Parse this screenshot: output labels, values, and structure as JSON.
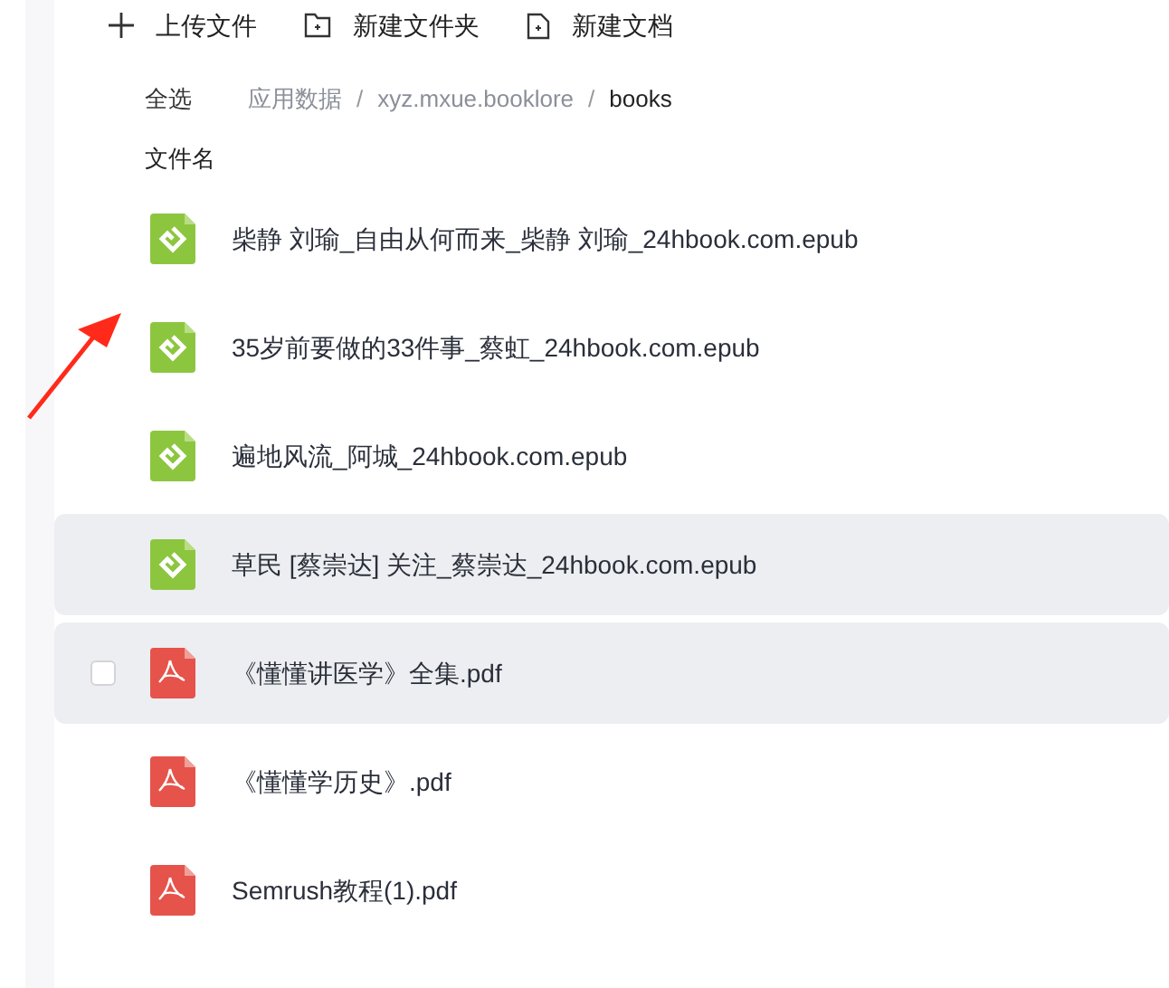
{
  "toolbar": [
    {
      "kind": "plus",
      "label": "上传文件"
    },
    {
      "kind": "folder",
      "label": "新建文件夹"
    },
    {
      "kind": "doc",
      "label": "新建文档"
    }
  ],
  "select_all": "全选",
  "breadcrumb": [
    {
      "label": "应用数据",
      "selected": false
    },
    {
      "label": "xyz.mxue.booklore",
      "selected": false
    },
    {
      "label": "books",
      "selected": true
    }
  ],
  "breadcrumb_separator": "/",
  "column_header": "文件名",
  "files": [
    {
      "kind": "epub",
      "name": "柴静 刘瑜_自由从何而来_柴静 刘瑜_24hbook.com.epub",
      "highlighted": false,
      "checkbox_shown": false
    },
    {
      "kind": "epub",
      "name": "35岁前要做的33件事_蔡虹_24hbook.com.epub",
      "highlighted": false,
      "checkbox_shown": false
    },
    {
      "kind": "epub",
      "name": "遍地风流_阿城_24hbook.com.epub",
      "highlighted": false,
      "checkbox_shown": false
    },
    {
      "kind": "epub",
      "name": "草民 [蔡崇达] 关注_蔡崇达_24hbook.com.epub",
      "highlighted": true,
      "checkbox_shown": false
    },
    {
      "kind": "pdf",
      "name": "《懂懂讲医学》全集.pdf",
      "highlighted": true,
      "checkbox_shown": true
    },
    {
      "kind": "pdf",
      "name": "《懂懂学历史》.pdf",
      "highlighted": false,
      "checkbox_shown": false
    },
    {
      "kind": "pdf",
      "name": "Semrush教程(1).pdf",
      "highlighted": false,
      "checkbox_shown": false
    }
  ]
}
